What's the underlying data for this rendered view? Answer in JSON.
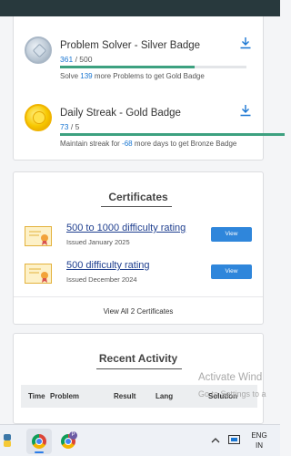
{
  "badges": [
    {
      "title": "Problem Solver - Silver Badge",
      "current": "361",
      "total": "/ 500",
      "progress": 0.722,
      "hint_prefix": "Solve",
      "hint_number": "139",
      "hint_suffix": "more Problems to get Gold Badge",
      "icon": "silver-badge-icon"
    },
    {
      "title": "Daily Streak - Gold Badge",
      "current": "73",
      "total": "/ 5",
      "progress": 1.0,
      "hint_prefix": "Maintain streak for",
      "hint_number": "-68",
      "hint_suffix": "more days to get Bronze Badge",
      "icon": "gold-badge-icon"
    }
  ],
  "certificates": {
    "title": "Certificates",
    "items": [
      {
        "title": "500 to 1000 difficulty rating",
        "issued": "Issued January 2025",
        "button": "View"
      },
      {
        "title": "500 difficulty rating",
        "issued": "Issued December 2024",
        "button": "View"
      }
    ],
    "view_all": "View All 2 Certificates"
  },
  "activity": {
    "title": "Recent Activity",
    "columns": [
      "Time",
      "Problem",
      "Result",
      "Lang",
      "Solution"
    ]
  },
  "watermark": {
    "line1": "Activate Wind",
    "line2": "Go to Settings to a"
  },
  "taskbar": {
    "language_line1": "ENG",
    "language_line2": "IN"
  },
  "colors": {
    "accent": "#1976d2",
    "progress": "#3da180",
    "topbar": "#28393d",
    "view_button": "#2f86db"
  }
}
